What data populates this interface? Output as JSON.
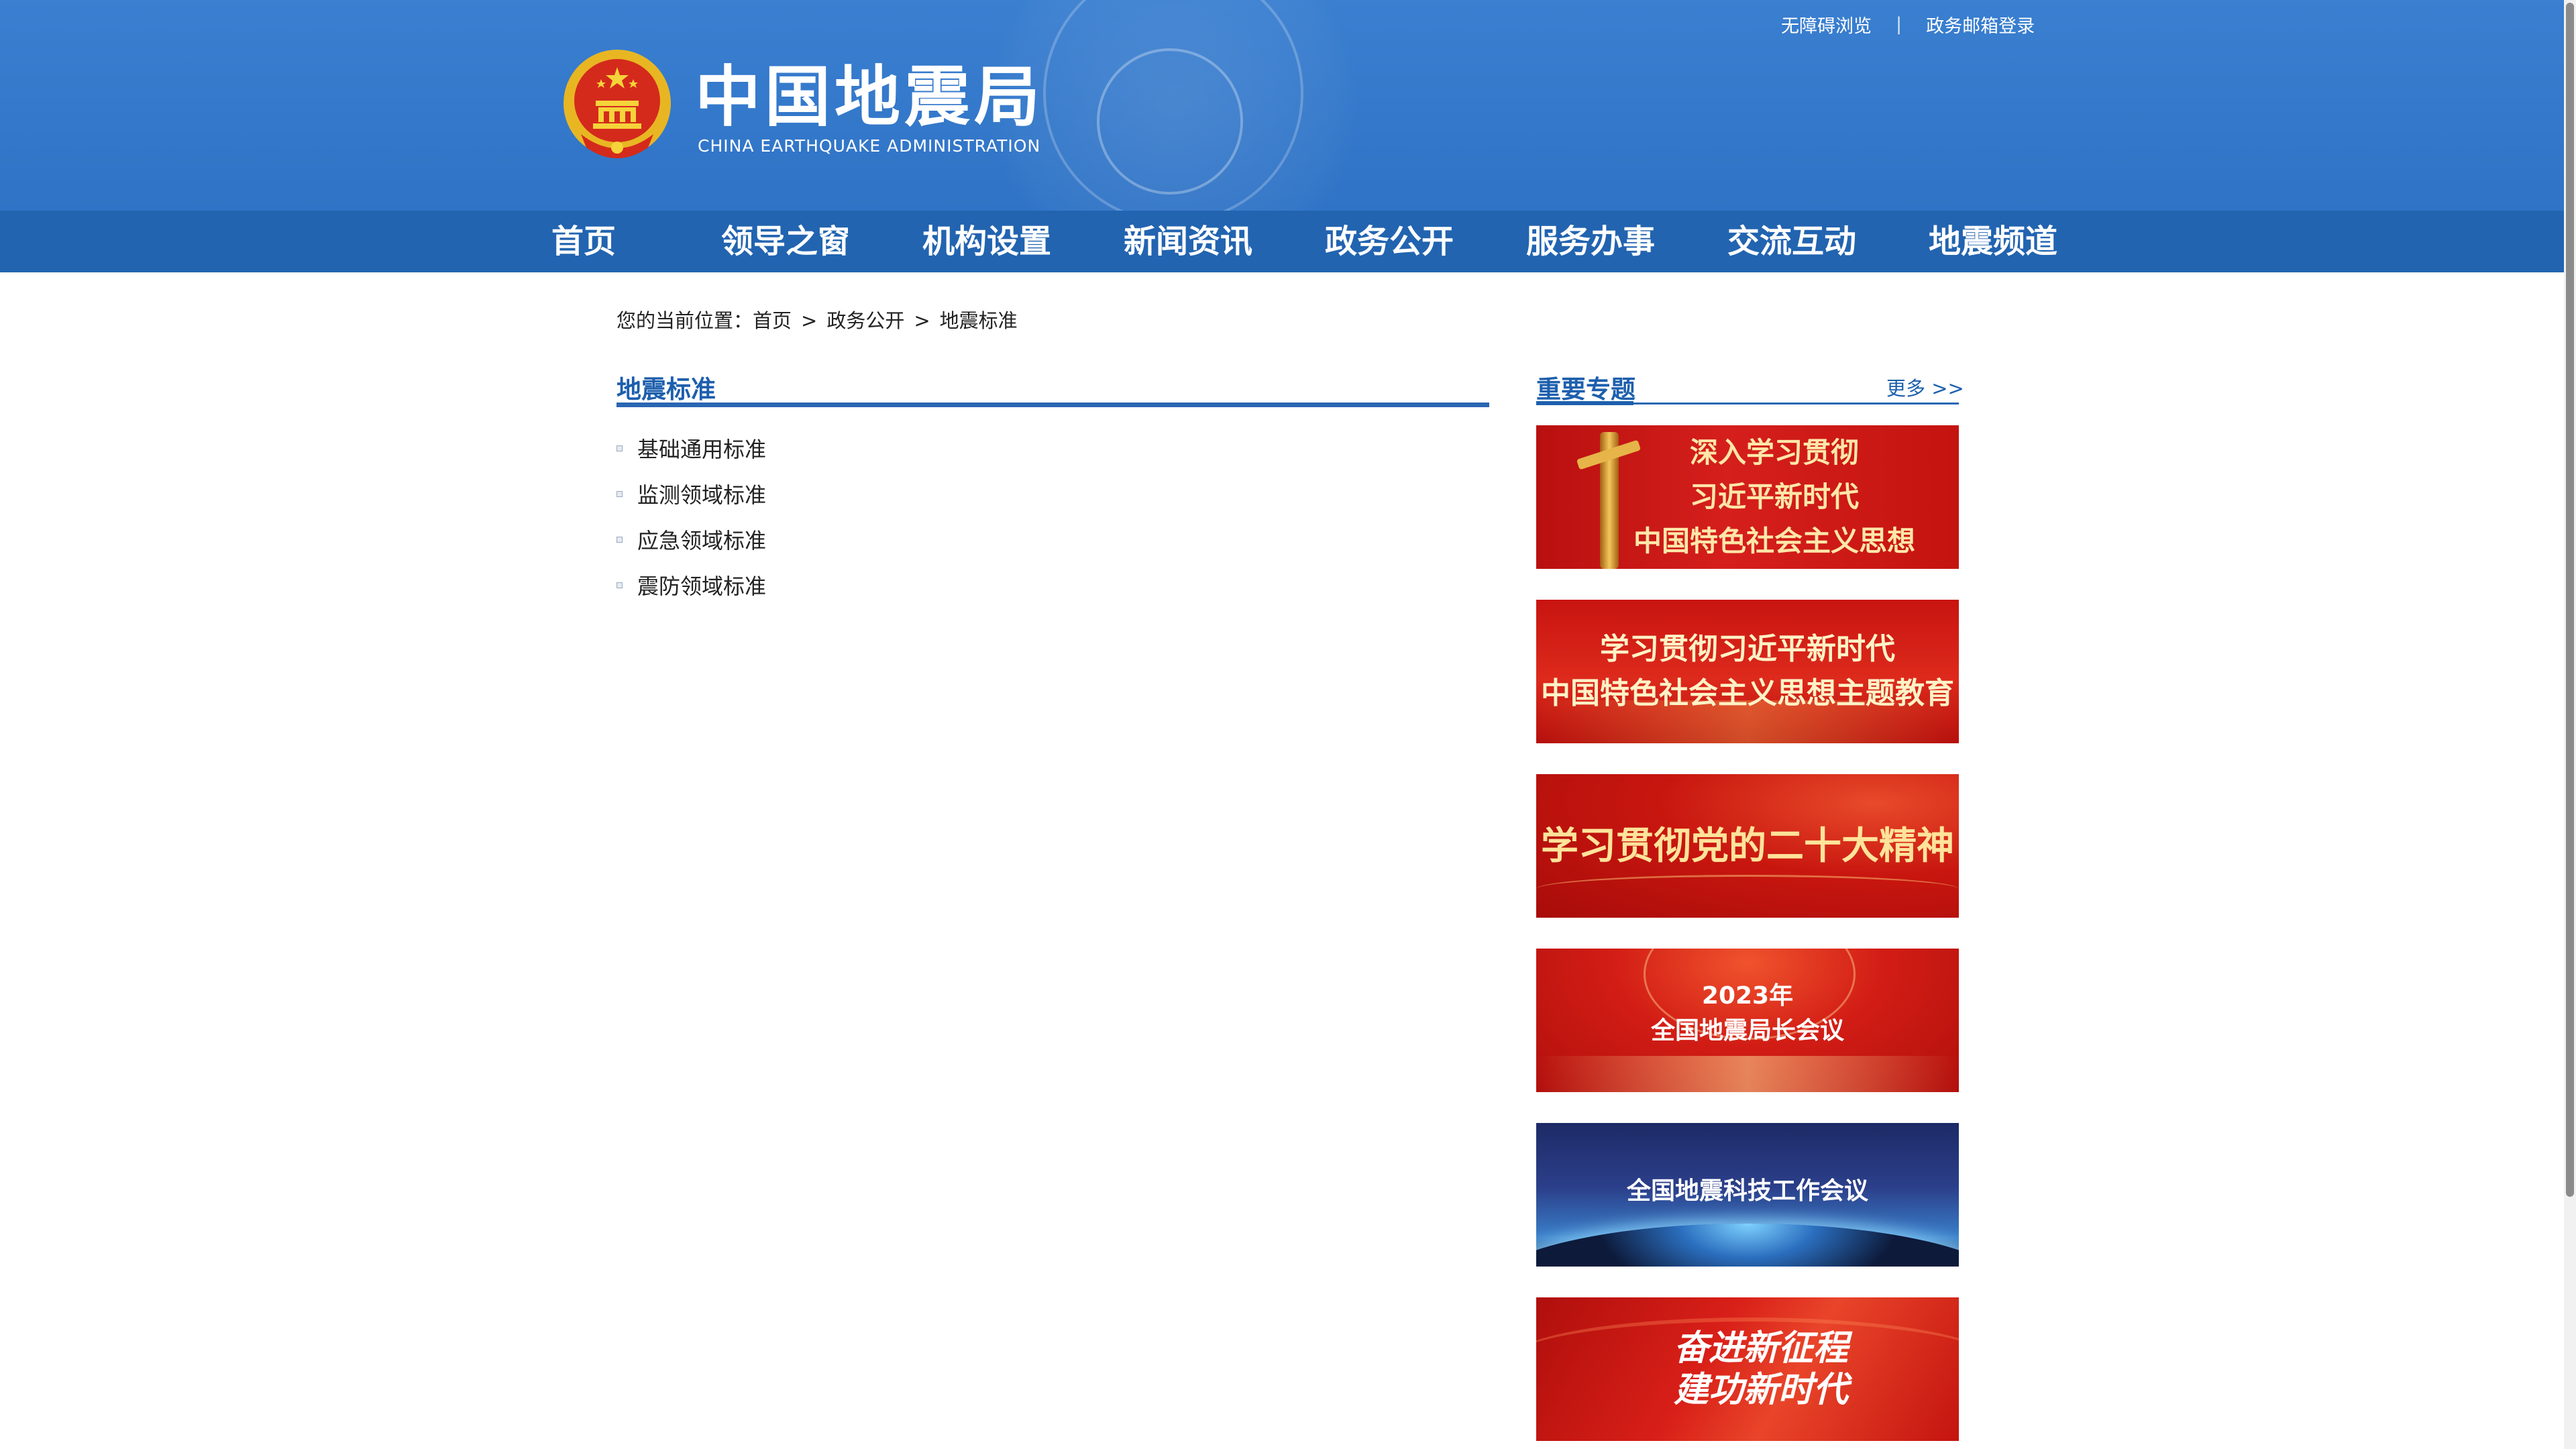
{
  "header": {
    "top_links": [
      "无障碍浏览",
      "政务邮箱登录"
    ],
    "separator": "|",
    "logo": {
      "title_cn": "中国地震局",
      "title_en": "CHINA EARTHQUAKE ADMINISTRATION",
      "emblem_icon": "national-emblem-icon"
    },
    "colors": {
      "header_bg": "#2f73c6",
      "nav_bg": "#2264b0"
    }
  },
  "nav": [
    "首页",
    "领导之窗",
    "机构设置",
    "新闻资讯",
    "政务公开",
    "服务办事",
    "交流互动",
    "地震频道"
  ],
  "breadcrumb": {
    "prefix": "您的当前位置：",
    "items": [
      "首页",
      "政务公开",
      "地震标准"
    ],
    "separator": ">"
  },
  "main": {
    "title": "地震标准",
    "items": [
      "基础通用标准",
      "监测领域标准",
      "应急领域标准",
      "震防领域标准"
    ]
  },
  "side": {
    "title": "重要专题",
    "more": "更多 >>",
    "banners": [
      {
        "text": "深入学习贯彻\n习近平新时代\n中国特色社会主义思想"
      },
      {
        "text": "学习贯彻习近平新时代\n中国特色社会主义思想主题教育"
      },
      {
        "text": "学习贯彻党的二十大精神"
      },
      {
        "text": "2023年\n全国地震局长会议"
      },
      {
        "text": "全国地震科技工作会议"
      },
      {
        "text": "奋进新征程\n建功新时代"
      }
    ]
  }
}
